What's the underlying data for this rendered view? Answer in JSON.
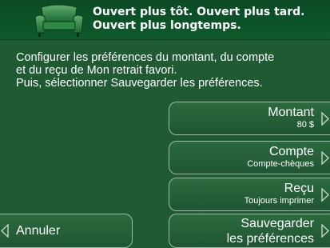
{
  "header": {
    "line1": "Ouvert plus tôt.  Ouvert plus tard.",
    "line2": "Ouvert plus longtemps.",
    "logo_icon": "armchair-icon"
  },
  "instructions": {
    "line1": "Configurer les préférences du montant, du compte",
    "line2": "et du reçu de Mon retrait favori.",
    "line3": "Puis, sélectionner Sauvegarder les préférences."
  },
  "options": [
    {
      "label": "Montant",
      "value": "80 $"
    },
    {
      "label": "Compte",
      "value": "Compte-chèques"
    },
    {
      "label": "Reçu",
      "value": "Toujours imprimer"
    }
  ],
  "actions": {
    "cancel_label": "Annuler",
    "save_line1": "Sauvegarder",
    "save_line2": "les préférences"
  },
  "colors": {
    "background": "#1f5a33",
    "header": "#0b4a24",
    "button_border": "#9fbca6",
    "arrow": "#b8d0bd"
  }
}
